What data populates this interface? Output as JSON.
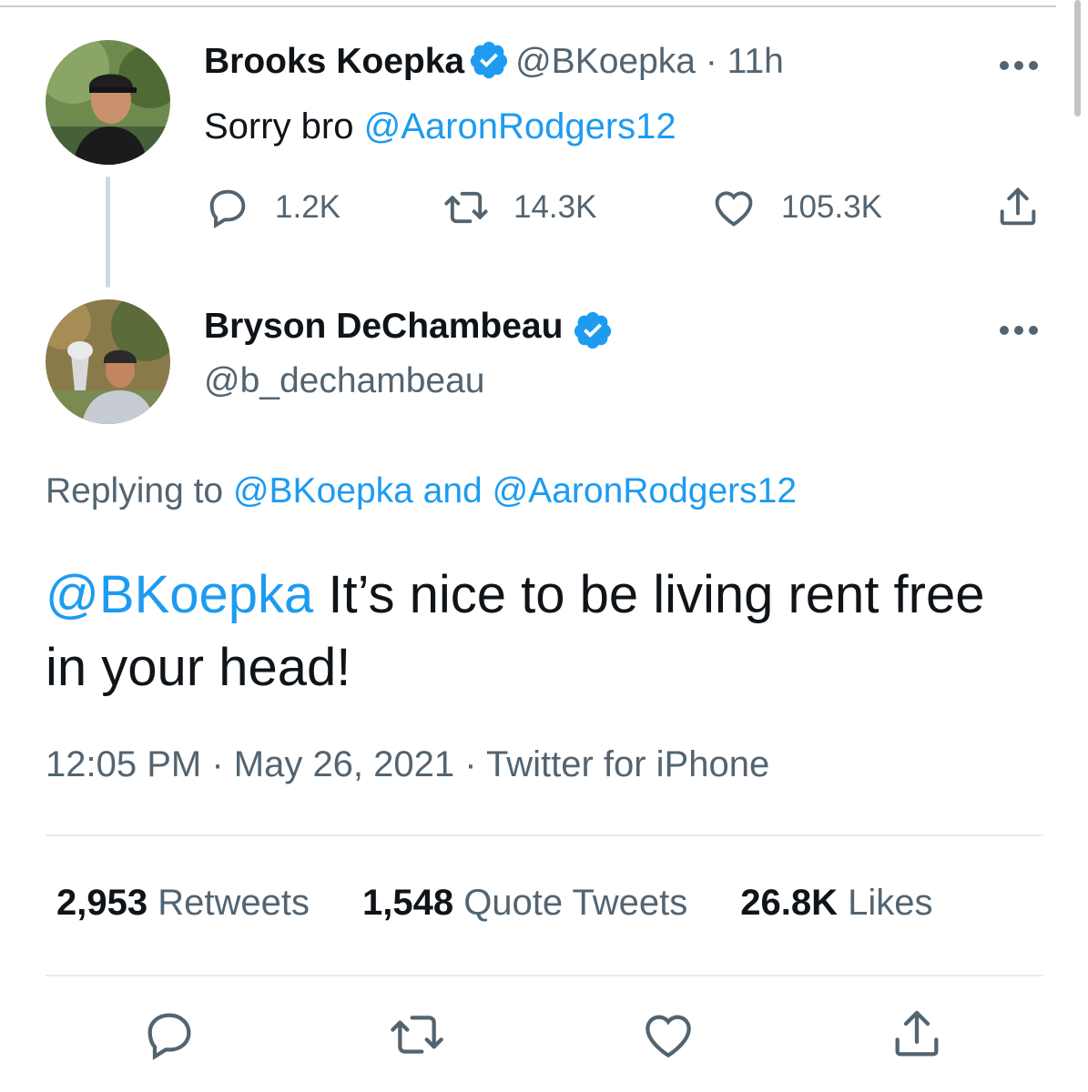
{
  "tweet1": {
    "name": "Brooks Koepka",
    "handle": "@BKoepka",
    "time": " · 11h",
    "text_prefix": "Sorry bro ",
    "mention": "@AaronRodgers12",
    "reply_count": "1.2K",
    "retweet_count": "14.3K",
    "like_count": "105.3K"
  },
  "tweet2": {
    "name": "Bryson DeChambeau",
    "handle": "@b_dechambeau",
    "replying_prefix": "Replying to ",
    "replying_user1": "@BKoepka",
    "replying_and": " and ",
    "replying_user2": "@AaronRodgers12",
    "mention": "@BKoepka",
    "text": " It’s nice to be living rent free in your head!",
    "timestamp": "12:05 PM · May 26, 2021 · Twitter for iPhone"
  },
  "stats": {
    "retweets_count": "2,953",
    "retweets_label": " Retweets",
    "quotes_count": "1,548",
    "quotes_label": " Quote Tweets",
    "likes_count": "26.8K",
    "likes_label": " Likes"
  },
  "icons": {
    "verified": "verified-badge-icon",
    "reply": "reply-icon",
    "retweet": "retweet-icon",
    "like": "heart-icon",
    "share": "share-icon",
    "more": "more-icon"
  },
  "colors": {
    "link": "#1d9bf0",
    "muted": "#536471",
    "text": "#0f1419",
    "verified": "#1d9bf0"
  }
}
